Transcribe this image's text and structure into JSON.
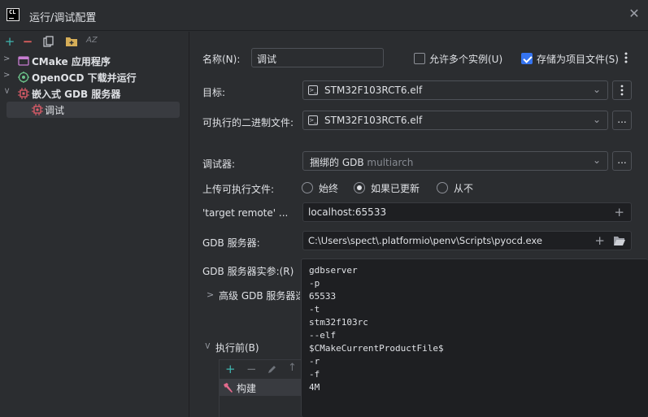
{
  "window": {
    "app_logo_text": "CL",
    "title": "运行/调试配置"
  },
  "left_toolbar": {
    "add_icon": "plus-icon",
    "remove_icon": "minus-icon",
    "copy_icon": "copy-icon",
    "folder_icon": "new-folder-icon",
    "sort_label": "AZ"
  },
  "tree": {
    "items": [
      {
        "label": "CMake 应用程序",
        "icon": "cmake-app-icon",
        "expanded": false
      },
      {
        "label": "OpenOCD 下载并运行",
        "icon": "openocd-icon",
        "expanded": false
      },
      {
        "label": "嵌入式 GDB 服务器",
        "icon": "embedded-gdb-icon",
        "expanded": true
      },
      {
        "label": "调试",
        "icon": "chip-icon",
        "selected": true
      }
    ]
  },
  "form": {
    "name_label": "名称(N):",
    "name_value": "调试",
    "allow_parallel_label": "允许多个实例(U)",
    "allow_parallel_checked": false,
    "store_as_file_label": "存储为项目文件(S)",
    "store_as_file_checked": true,
    "target_label": "目标:",
    "target_value": "STM32F103RCT6.elf",
    "executable_label": "可执行的二进制文件:",
    "executable_value": "STM32F103RCT6.elf",
    "browse_label": "...",
    "debugger_label": "调试器:",
    "debugger_value": "捆绑的 GDB",
    "debugger_hint": "multiarch",
    "upload_label": "上传可执行文件:",
    "upload_options": [
      {
        "label": "始终",
        "selected": false
      },
      {
        "label": "如果已更新",
        "selected": true
      },
      {
        "label": "从不",
        "selected": false
      }
    ],
    "target_remote_label": "'target remote' ...",
    "target_remote_value": "localhost:65533",
    "gdb_server_label": "GDB 服务器:",
    "gdb_server_value": "C:\\Users\\spect\\.platformio\\penv\\Scripts\\pyocd.exe",
    "gdb_args_label": "GDB 服务器实参:(R)",
    "gdb_args_lines": [
      "gdbserver",
      "-p",
      "65533",
      "-t",
      "stm32f103rc",
      "--elf",
      "$CMakeCurrentProductFile$",
      "-r",
      "-f",
      "4M"
    ],
    "advanced_label": "高级 GDB 服务器选",
    "before_launch_label": "执行前(B)",
    "before_launch_items": [
      {
        "label": "构建",
        "icon": "hammer-icon"
      }
    ]
  },
  "colors": {
    "accent": "#3574f0",
    "background": "#2b2d30",
    "input_background": "#1e1f22",
    "add_green": "#3fb6b0",
    "remove_red": "#e06060"
  }
}
